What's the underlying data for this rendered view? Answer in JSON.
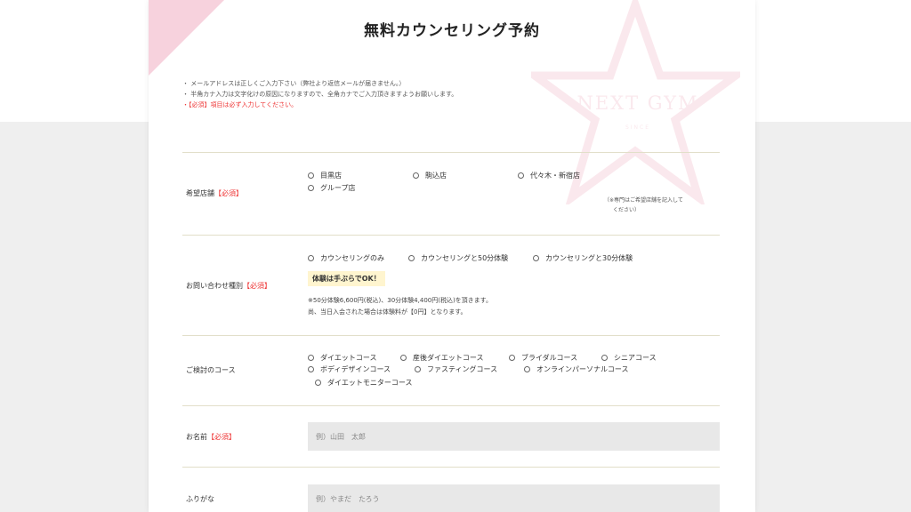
{
  "title": "無料カウンセリング予約",
  "logo": {
    "name": "NEXT GYM",
    "sub": "SINCE"
  },
  "notes": [
    "・ メールアドレスは正しくご入力下さい（弊社より返信メールが届きません。）",
    "・ 半角カナ入力は文字化けの原因になりますので、全角カナでご入力頂きますようお願いします。",
    "・【必須】項目は必ず入力してください。"
  ],
  "required_mark": "【必須】",
  "store": {
    "label": "希望店舗",
    "options": [
      "目黒店",
      "駒込店",
      "代々木・新宿店",
      "グループ店"
    ],
    "note_line1": "（※専門はご希望店舗を記入して",
    "note_line2": "ください）"
  },
  "inquiry": {
    "label": "お問い合わせ種別",
    "options": [
      "カウンセリングのみ",
      "カウンセリングと50分体験",
      "カウンセリングと30分体験"
    ],
    "badge": "体験は手ぶらでOK！",
    "info_line1": "※50分体験6,600円(税込)、30分体験4,400円(税込)を頂きます。",
    "info_line2": "尚、当日入会された場合は体験料が【0円】となります。"
  },
  "course": {
    "label": "ご検討のコース",
    "options": [
      "ダイエットコース",
      "産後ダイエットコース",
      "ブライダルコース",
      "シニアコース",
      "ボディデザインコース",
      "ファスティングコース",
      "オンラインパーソナルコース",
      "ダイエットモニターコース"
    ]
  },
  "name": {
    "label": "お名前",
    "placeholder": "例）山田　太郎"
  },
  "furigana": {
    "label": "ふりがな",
    "placeholder": "例）やまだ　たろう"
  },
  "colors": {
    "required": "#e33333",
    "divider": "#e2dfc9",
    "accent_pink": "#f7d2dd"
  }
}
